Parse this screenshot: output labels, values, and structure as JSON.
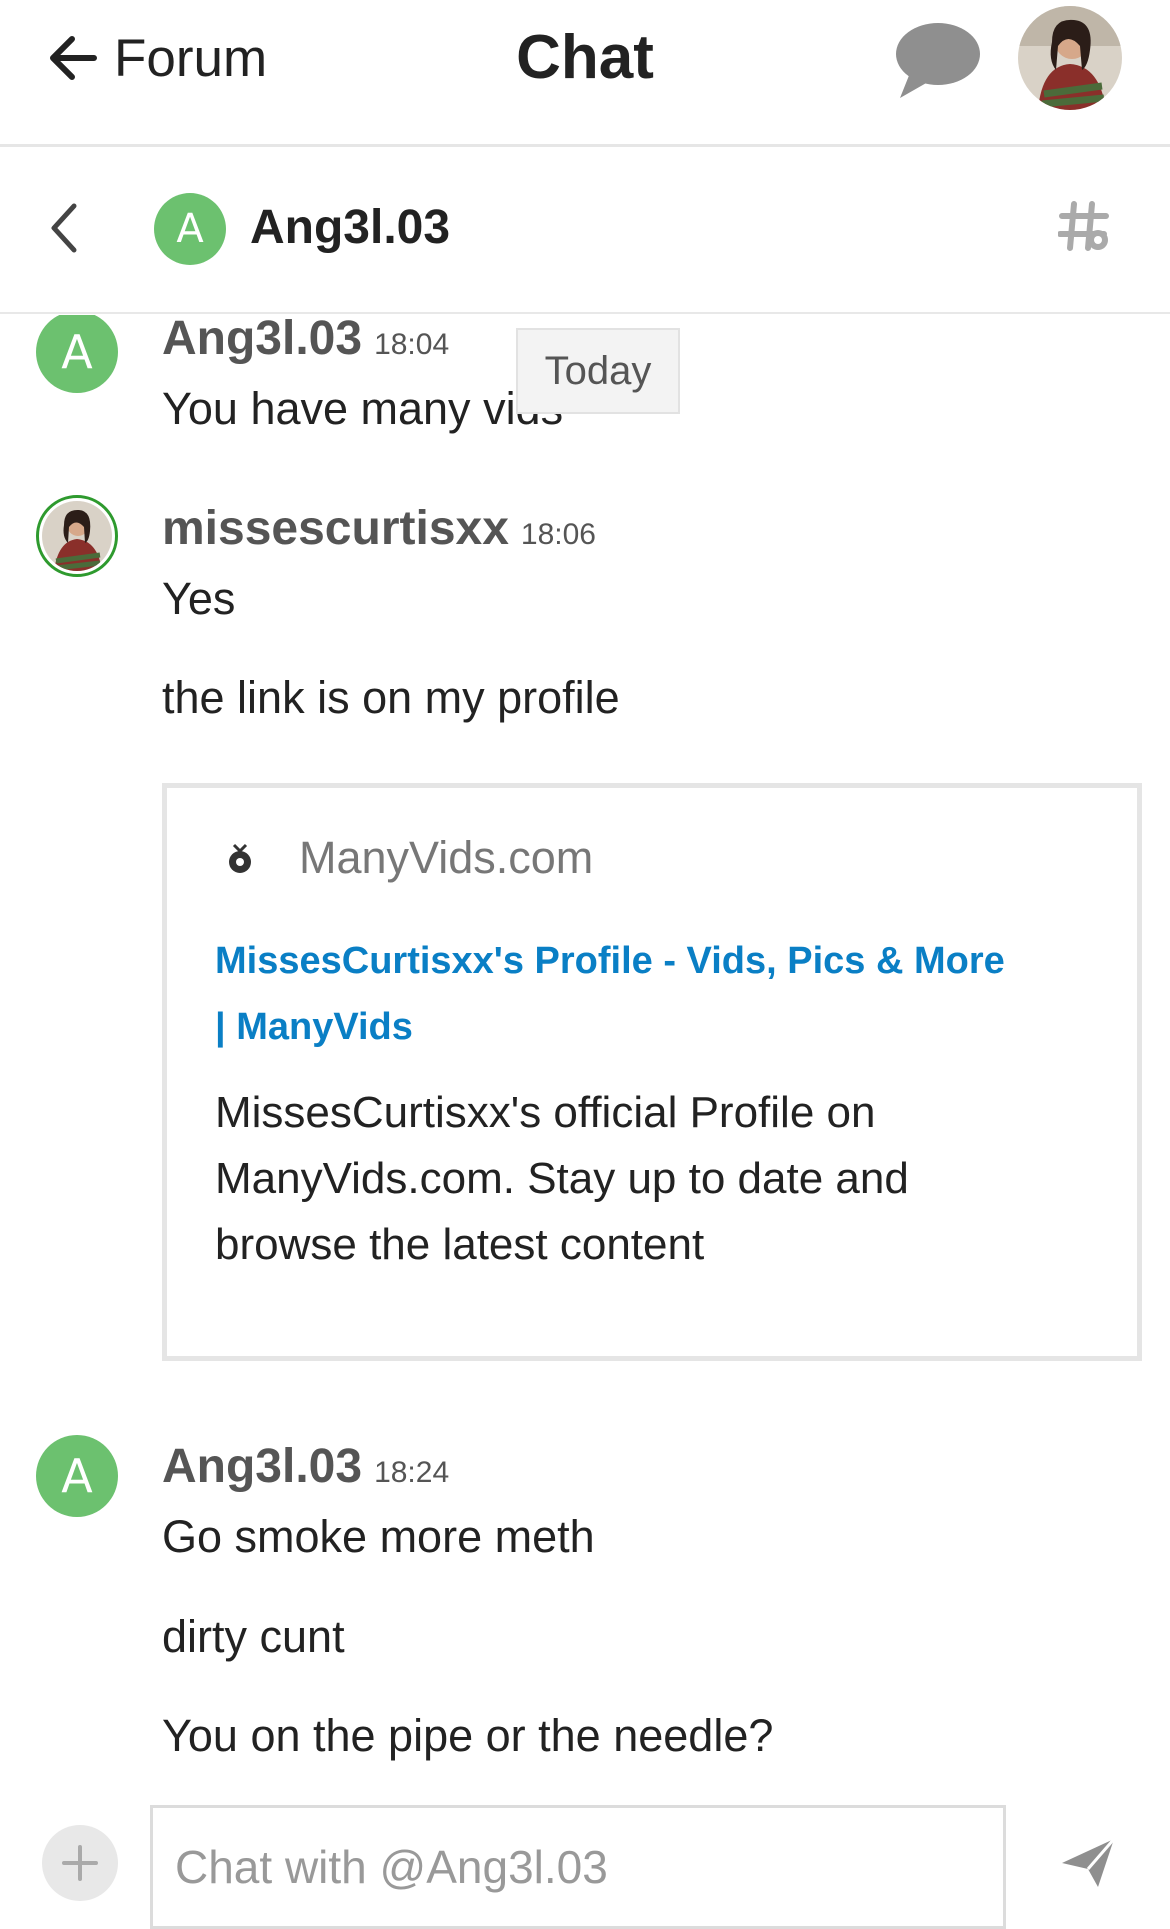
{
  "header": {
    "back_label": "Forum",
    "title": "Chat",
    "icons": {
      "back": "arrow-left-icon",
      "chat": "chat-bubble-icon",
      "avatar": "user-avatar"
    }
  },
  "channel": {
    "avatar_letter": "A",
    "name": "Ang3l.03",
    "icons": {
      "back": "chevron-left-icon",
      "settings": "channel-settings-icon"
    }
  },
  "date_separator": "Today",
  "messages": [
    {
      "username": "Ang3l.03",
      "time": "18:04",
      "avatar_letter": "A",
      "texts": [
        "You have many vids"
      ]
    },
    {
      "username": "missescurtisxx",
      "time": "18:06",
      "texts": [
        "Yes",
        "the link is on my profile"
      ]
    },
    {
      "username": "Ang3l.03",
      "time": "18:24",
      "avatar_letter": "A",
      "texts": [
        "Go smoke more meth",
        "dirty cunt",
        "You on the pipe or the needle?"
      ]
    }
  ],
  "onebox": {
    "domain": "ManyVids.com",
    "title_line1": "MissesCurtisxx's Profile - Vids, Pics & More",
    "title_line2": "| ManyVids",
    "desc_line1": "MissesCurtisxx's official Profile on",
    "desc_line2": "ManyVids.com. Stay up to date and",
    "desc_line3": "browse the latest content"
  },
  "composer": {
    "placeholder": "Chat with @Ang3l.03",
    "icons": {
      "upload": "plus-icon",
      "send": "send-icon"
    }
  },
  "colors": {
    "avatar_green": "#6cc16f",
    "link_blue": "#0a7fc5",
    "border": "#e5e5e5"
  }
}
